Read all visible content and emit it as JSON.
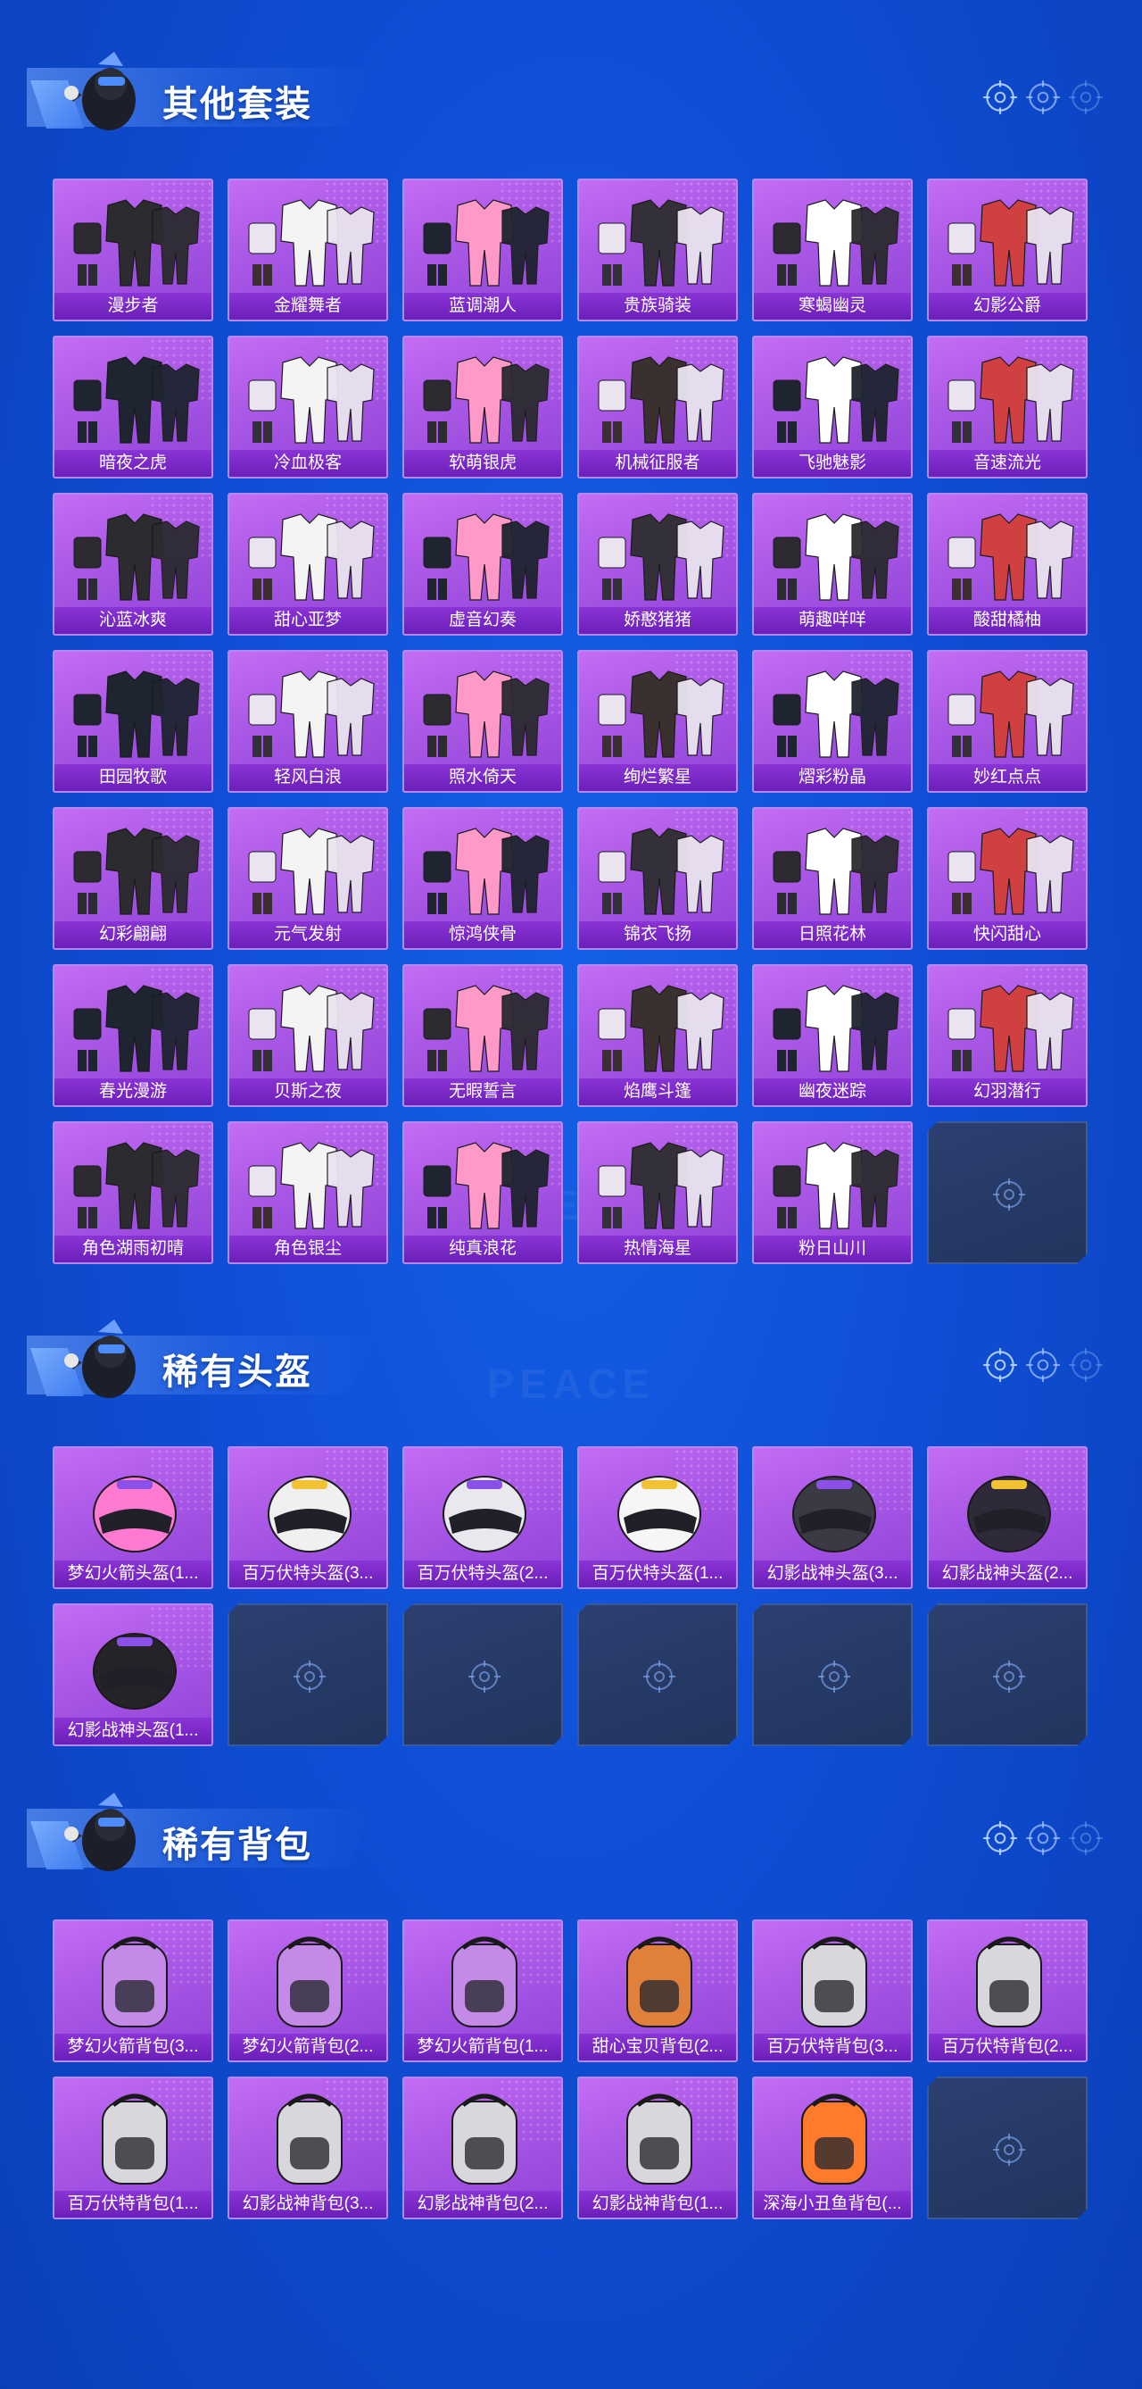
{
  "sections": [
    {
      "title": "其他套装",
      "kind": "outfit",
      "items": [
        "漫步者",
        "金耀舞者",
        "蓝调潮人",
        "贵族骑装",
        "寒蝎幽灵",
        "幻影公爵",
        "暗夜之虎",
        "冷血极客",
        "软萌银虎",
        "机械征服者",
        "飞驰魅影",
        "音速流光",
        "沁蓝冰爽",
        "甜心亚梦",
        "虚音幻奏",
        "娇憨猪猪",
        "萌趣咩咩",
        "酸甜橘柚",
        "田园牧歌",
        "轻风白浪",
        "照水倚天",
        "绚烂繁星",
        "熠彩粉晶",
        "妙红点点",
        "幻彩翩翩",
        "元气发射",
        "惊鸿侠骨",
        "锦衣飞扬",
        "日照花林",
        "快闪甜心",
        "春光漫游",
        "贝斯之夜",
        "无暇誓言",
        "焰鹰斗篷",
        "幽夜迷踪",
        "幻羽潜行",
        "角色湖雨初晴",
        "角色银尘",
        "纯真浪花",
        "热情海星",
        "粉日山川"
      ],
      "empty_slots": 1
    },
    {
      "title": "稀有头盔",
      "kind": "helmet",
      "items": [
        "梦幻火箭头盔(1...",
        "百万伏特头盔(3...",
        "百万伏特头盔(2...",
        "百万伏特头盔(1...",
        "幻影战神头盔(3...",
        "幻影战神头盔(2...",
        "幻影战神头盔(1..."
      ],
      "empty_slots": 5
    },
    {
      "title": "稀有背包",
      "kind": "backpack",
      "items": [
        "梦幻火箭背包(3...",
        "梦幻火箭背包(2...",
        "梦幻火箭背包(1...",
        "甜心宝贝背包(2...",
        "百万伏特背包(3...",
        "百万伏特背包(2...",
        "百万伏特背包(1...",
        "幻影战神背包(3...",
        "幻影战神背包(2...",
        "幻影战神背包(1...",
        "深海小丑鱼背包(..."
      ],
      "empty_slots": 1
    }
  ],
  "watermark": "GAME FOR PEACE",
  "colors": {
    "card": "#a957e6",
    "label_bar": "#7a28c8",
    "empty": "#273b66",
    "accent": "#b688ff"
  }
}
